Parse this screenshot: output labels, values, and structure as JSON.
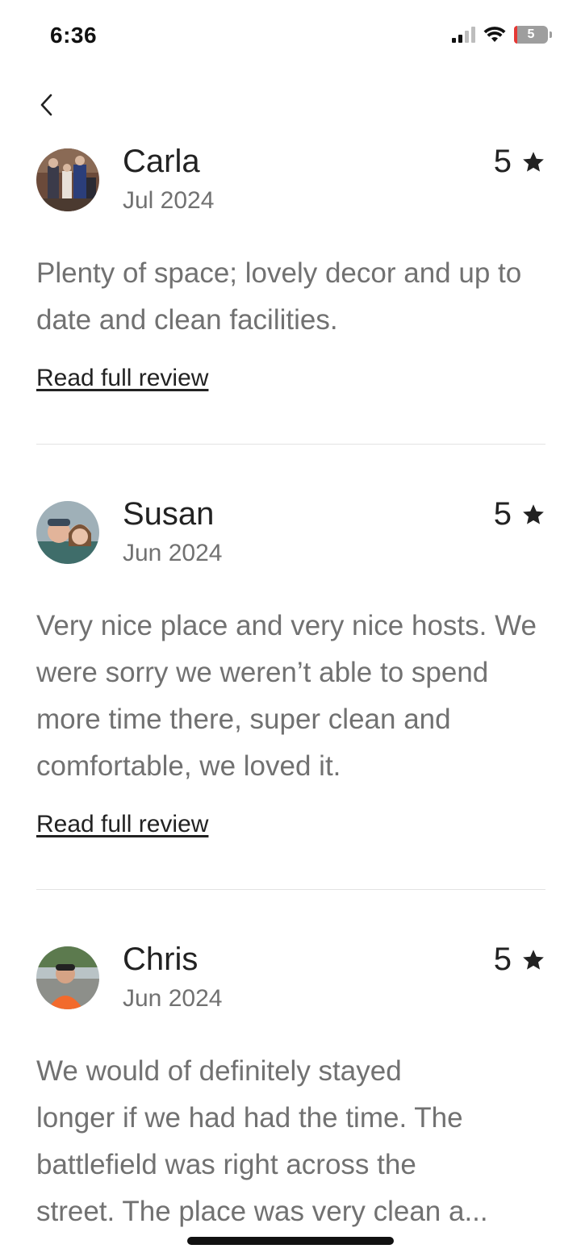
{
  "status_bar": {
    "time": "6:36",
    "battery_level": "5"
  },
  "navigation": {
    "back_icon": "chevron-left-icon"
  },
  "star_icon": "star-icon",
  "reviews": [
    {
      "name": "Carla",
      "date": "Jul 2024",
      "rating": "5",
      "text": "Plenty of space; lovely decor and up to date and clean facilities.",
      "read_more": "Read full review"
    },
    {
      "name": "Susan",
      "date": "Jun 2024",
      "rating": "5",
      "text": "Very nice place and very nice hosts. We were sorry we weren’t able to spend more time there, super clean and comfortable, we loved it.",
      "read_more": "Read full review"
    },
    {
      "name": "Chris",
      "date": "Jun 2024",
      "rating": "5",
      "text_lines": [
        "We would of definitely stayed",
        "longer if we had had the time. The",
        "battlefield was right across the",
        "street. The place was very clean a..."
      ]
    }
  ]
}
